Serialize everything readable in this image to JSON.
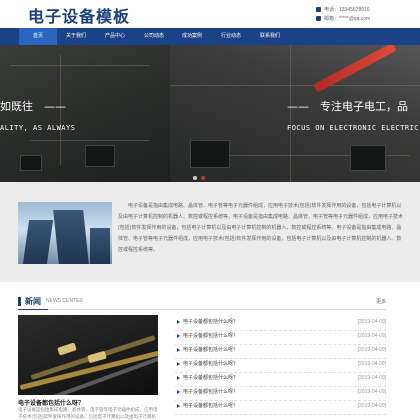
{
  "header": {
    "site_title": "电子设备模板",
    "phone": "电话：12345678910",
    "email": "邮箱：*****@qq.com"
  },
  "nav": {
    "items": [
      {
        "label": "首页"
      },
      {
        "label": "关于我们"
      },
      {
        "label": "产品中心"
      },
      {
        "label": "公司动态"
      },
      {
        "label": "成功案例"
      },
      {
        "label": "行业动态"
      },
      {
        "label": "联系我们"
      }
    ],
    "active_index": 0
  },
  "banner": {
    "left_cn": "如既往　——",
    "left_en": "ALITY, AS ALWAYS",
    "right_cn": "——　专注电子电工，品",
    "right_en": "FOCUS ON ELECTRONIC ELECTRIC",
    "dots": 2,
    "active_dot": 1
  },
  "about": {
    "text": "电子设备是指由集成电路、晶体管、电子管等电子元器件组成，应用电子技术(包括)软件发挥作用的设备，包括电子计算机以及由电子计算机控制的机器人、数控或程控系统等。电子设备是指由集成电路、晶体管、电子管等电子元器件组成，应用电子技术(包括)软件发挥作用的设备，包括电子计算机以及由电子计算机控制的机器人、数控或程控系统等。电子设备是指由集成电路、晶体管、电子管等电子元器件组成，应用电子技术(包括)软件发挥作用的设备，包括电子计算机以及由电子计算机控制的机器人、数控或程控系统等。"
  },
  "news": {
    "title": "新闻",
    "subtitle": "NEWS CENTER",
    "more": "更多",
    "feature_title": "电子设备都包括什么呀？",
    "feature_text": "电子设备是指由集成电路、晶体管、电子管等电子元器件组成，应用电子技术(包括)软件发挥作用的设备，包括电子计算机以及由电子计算机控制的机器人",
    "items": [
      {
        "title": "电子设备都包括什么呀？",
        "date": "[2019-04-09]"
      },
      {
        "title": "电子设备都包括什么呀？",
        "date": "[2019-04-09]"
      },
      {
        "title": "电子设备都包括什么呀？",
        "date": "[2019-04-09]"
      },
      {
        "title": "电子设备都包括什么呀？",
        "date": "[2019-04-09]"
      },
      {
        "title": "电子设备都包括什么呀？",
        "date": "[2019-04-09]"
      },
      {
        "title": "电子设备都包括什么呀？",
        "date": "[2019-04-09]"
      },
      {
        "title": "电子设备都包括什么呀？",
        "date": "[2019-04-09]"
      }
    ]
  },
  "colors": {
    "brand": "#1a4286",
    "nav_active": "#2a66c0",
    "about_bg": "#ececec"
  }
}
